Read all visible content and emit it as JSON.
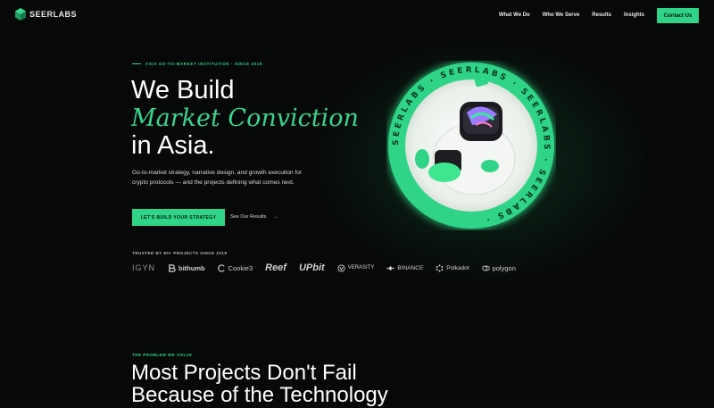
{
  "nav": {
    "logo_text": "SEERLABS",
    "links": [
      "What We Do",
      "Who We Serve",
      "Results",
      "Insights"
    ],
    "contact_label": "Contact Us"
  },
  "hero": {
    "eyebrow": "ASIA GO-TO-MARKET INSTITUTION · SINCE 2018",
    "title_line1": "We Build",
    "title_line2": "Market Conviction",
    "title_line3": "in Asia.",
    "description": "Go-to-market strategy, narrative design, and growth execution for crypto protocols — and the projects defining what comes next.",
    "cta_label": "LET'S BUILD YOUR STRATEGY",
    "secondary_link": "See Our Results",
    "secondary_arrow": "→"
  },
  "trusted": {
    "label": "TRUSTED BY 80+ PROJECTS SINCE 2018",
    "brands": [
      "IGYN",
      "bithumb",
      "Cookie3",
      "Reef",
      "UPbit",
      "VERASITY",
      "BINANCE",
      "Polkadot",
      "polygon"
    ]
  },
  "badge": {
    "ring_text": "SEERLABS · SEERLABS · SEERLABS · SEERLABS ·"
  },
  "problem": {
    "label": "THE PROBLEM WE SOLVE",
    "title_line1": "Most Projects Don't Fail",
    "title_line2": "Because of the Technology"
  },
  "colors": {
    "accent": "#2fd486",
    "background": "#070908",
    "italic_green": "#3ad48d"
  }
}
